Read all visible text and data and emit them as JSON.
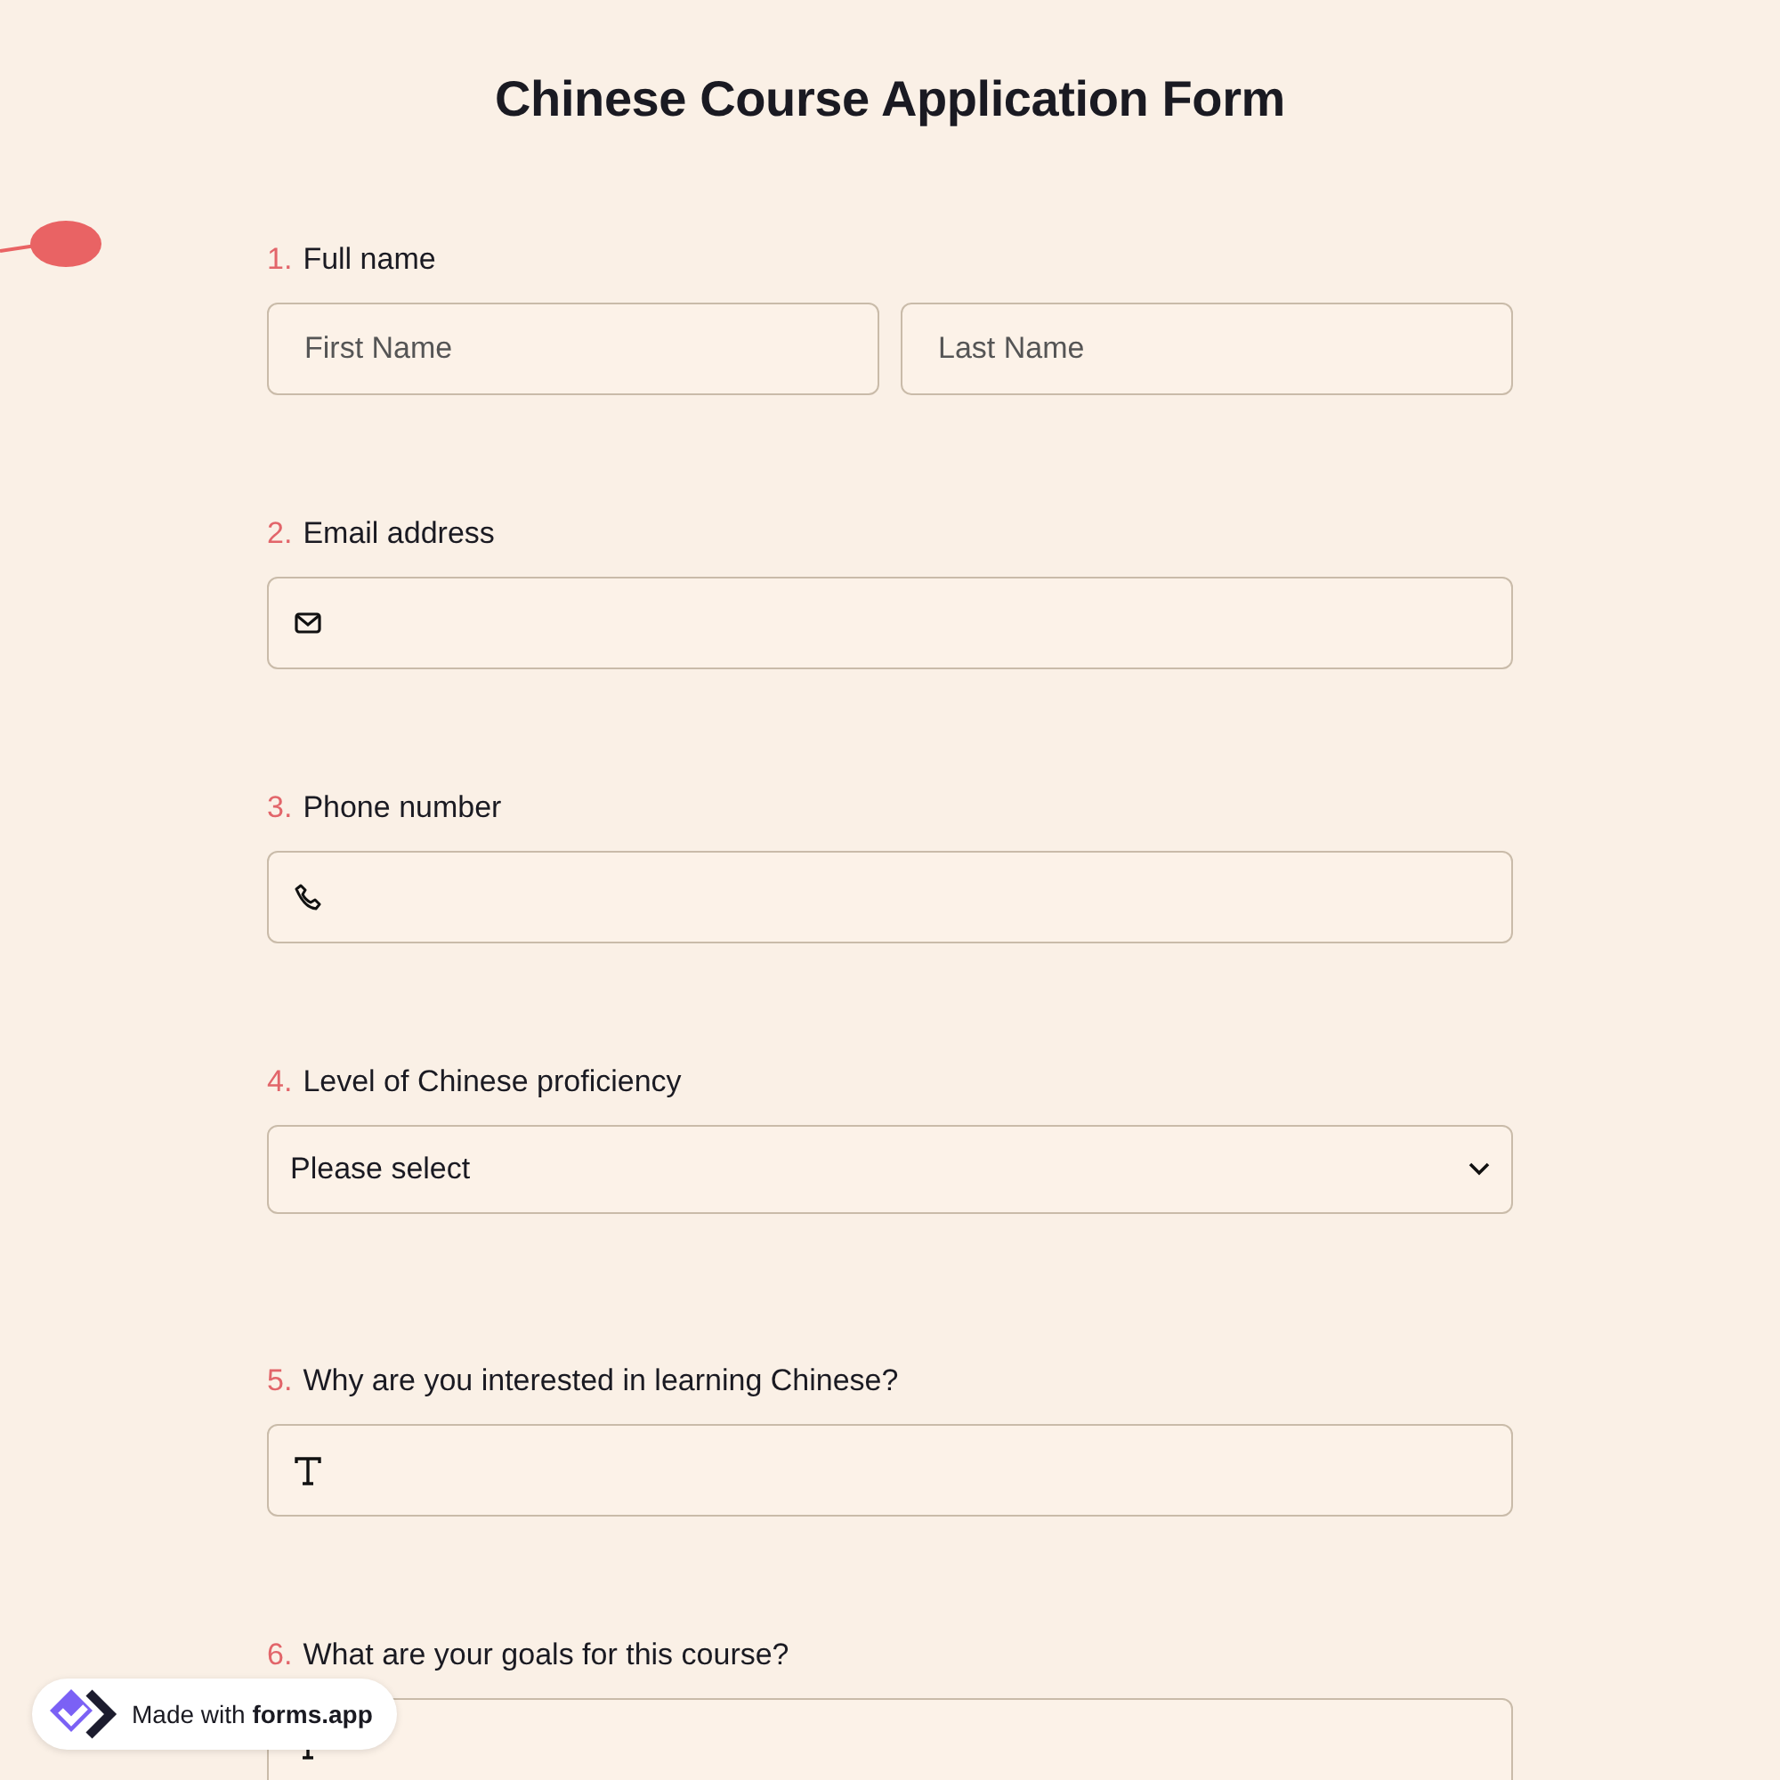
{
  "title": "Chinese Course Application Form",
  "questions": [
    {
      "number": "1.",
      "label": "Full name",
      "kind": "name",
      "placeholders": [
        "First Name",
        "Last Name"
      ]
    },
    {
      "number": "2.",
      "label": "Email address",
      "kind": "email"
    },
    {
      "number": "3.",
      "label": "Phone number",
      "kind": "phone"
    },
    {
      "number": "4.",
      "label": "Level of Chinese proficiency",
      "kind": "select",
      "value": "Please select"
    },
    {
      "number": "5.",
      "label": "Why are you interested in learning Chinese?",
      "kind": "text"
    },
    {
      "number": "6.",
      "label": "What are your goals for this course?",
      "kind": "text"
    }
  ],
  "badge": {
    "text": "Made with **forms.app**"
  }
}
